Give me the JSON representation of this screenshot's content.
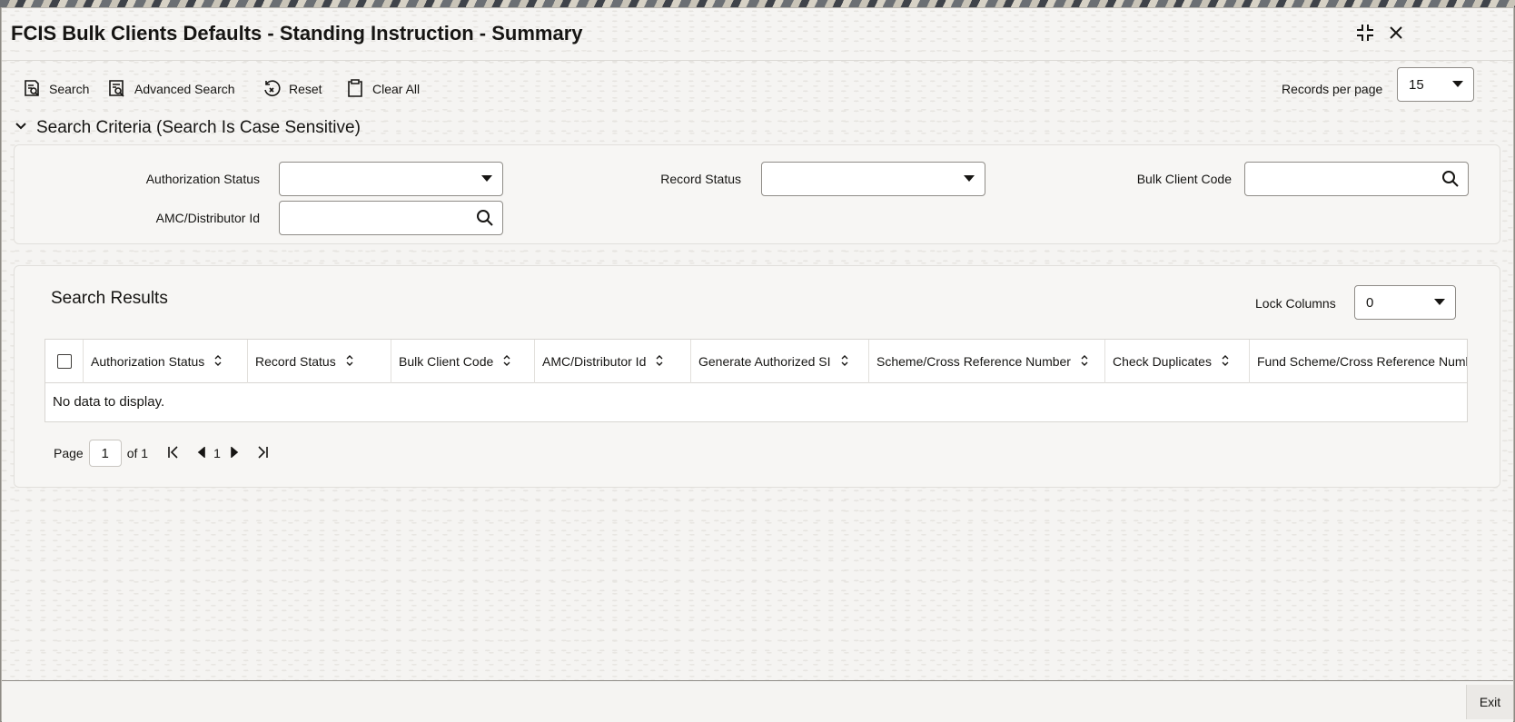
{
  "window": {
    "title": "FCIS Bulk Clients Defaults - Standing Instruction - Summary"
  },
  "toolbar": {
    "search_label": "Search",
    "advanced_search_label": "Advanced Search",
    "reset_label": "Reset",
    "clear_all_label": "Clear All",
    "records_per_page_label": "Records per page",
    "records_per_page_value": "15"
  },
  "criteria": {
    "header": "Search Criteria (Search Is Case Sensitive)",
    "authorization_status_label": "Authorization Status",
    "authorization_status_value": "",
    "record_status_label": "Record Status",
    "record_status_value": "",
    "bulk_client_code_label": "Bulk Client Code",
    "bulk_client_code_value": "",
    "amc_distributor_id_label": "AMC/Distributor Id",
    "amc_distributor_id_value": ""
  },
  "results": {
    "title": "Search Results",
    "lock_columns_label": "Lock Columns",
    "lock_columns_value": "0",
    "columns": [
      "Authorization Status",
      "Record Status",
      "Bulk Client Code",
      "AMC/Distributor Id",
      "Generate Authorized SI",
      "Scheme/Cross Reference Number",
      "Check Duplicates",
      "Fund Scheme/Cross Reference Number"
    ],
    "empty_message": "No data to display."
  },
  "pagination": {
    "page_label": "Page",
    "current_page": "1",
    "of_label": "of 1",
    "page_number": "1"
  },
  "footer": {
    "exit_label": "Exit"
  },
  "icons": {
    "minimize": "collapse-icon",
    "close": "close-icon",
    "search": "search-icon",
    "advanced_search": "advanced-search-icon",
    "reset": "reset-icon",
    "clear_all": "clipboard-clear-icon",
    "chevron": "chevron-down-icon",
    "sort": "sort-icon",
    "first_page": "first-page-icon",
    "prev_page": "prev-page-icon",
    "next_page": "next-page-icon",
    "last_page": "last-page-icon"
  }
}
